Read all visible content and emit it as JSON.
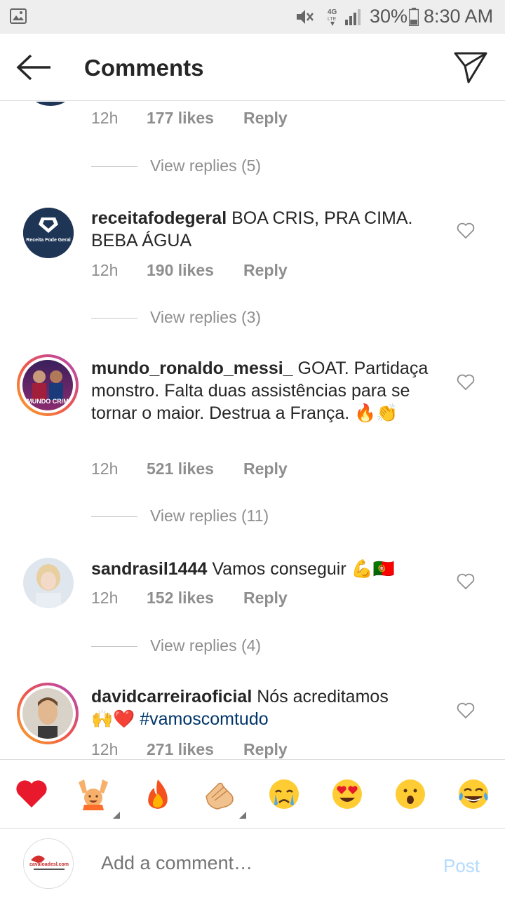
{
  "status_bar": {
    "battery": "30%",
    "time": "8:30 AM"
  },
  "header": {
    "title": "Comments"
  },
  "top_partial": {
    "time": "12h",
    "likes": "177 likes",
    "reply": "Reply",
    "view_replies": "View replies (5)"
  },
  "comments": [
    {
      "username": "receitafodegeral",
      "text": " BOA CRIS, PRA CIMA. BEBA ÁGUA",
      "avatar_text": "Receita Fode Geral",
      "time": "12h",
      "likes": "190 likes",
      "reply": "Reply",
      "view_replies": "View replies (3)"
    },
    {
      "username": "mundo_ronaldo_messi_",
      "text": " GOAT. Partidaça monstro. Falta duas assistências para se tornar o maior. Destrua a França. ",
      "emoji": "🔥👏",
      "avatar_text": "MUNDO CR/M",
      "time": "12h",
      "likes": "521 likes",
      "reply": "Reply",
      "view_replies": "View replies (11)"
    },
    {
      "username": "sandrasil1444",
      "text": " Vamos conseguir ",
      "emoji": "💪🇵🇹",
      "time": "12h",
      "likes": "152 likes",
      "reply": "Reply",
      "view_replies": "View replies (4)"
    },
    {
      "username": "davidcarreiraoficial",
      "text": " Nós acreditamos ",
      "emoji": "🙌❤️",
      "hashtag": " #vamoscomtudo",
      "time": "12h",
      "likes": "271 likes",
      "reply": "Reply"
    }
  ],
  "reactions": [
    "❤️",
    "🙌",
    "🔥",
    "👏",
    "😢",
    "😍",
    "😮",
    "😂"
  ],
  "composer": {
    "placeholder": "Add a comment…",
    "post_label": "Post",
    "avatar_text": "cavaloadesl.com"
  },
  "colors": {
    "hashtag": "#003569",
    "post_disabled": "#b3dbff",
    "meta_gray": "#8e8e8e"
  }
}
